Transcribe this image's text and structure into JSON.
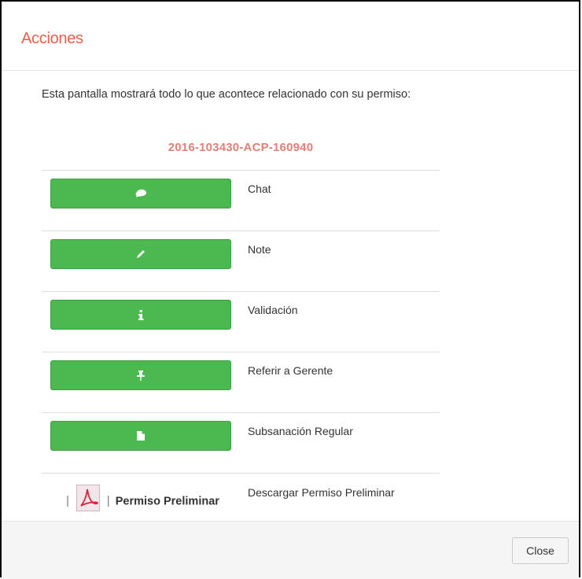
{
  "header": {
    "title": "Acciones"
  },
  "body": {
    "intro_text": "Esta pantalla mostrará todo lo que acontece relacionado con su permiso:",
    "permit_number": "2016-103430-ACP-160940",
    "actions": [
      {
        "icon": "comment-icon",
        "label": "Chat"
      },
      {
        "icon": "pencil-icon",
        "label": "Note"
      },
      {
        "icon": "info-icon",
        "label": "Validación"
      },
      {
        "icon": "pushpin-icon",
        "label": "Referir a Gerente"
      },
      {
        "icon": "file-icon",
        "label": "Subsanación Regular"
      }
    ],
    "download": {
      "separator": "|",
      "link_text": "Permiso Preliminar",
      "icon": "pdf-icon",
      "label": "Descargar Permiso Preliminar"
    }
  },
  "footer": {
    "close_label": "Close"
  },
  "colors": {
    "title": "#ef5d4a",
    "permit_number": "#e0807a",
    "button": "#4bb850"
  }
}
